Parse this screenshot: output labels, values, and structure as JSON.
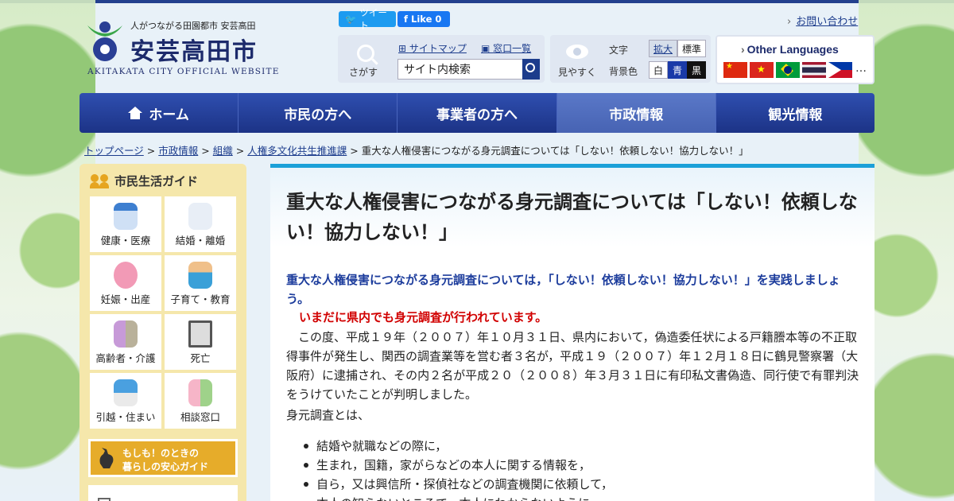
{
  "header": {
    "tagline": "人がつながる田園都市 安芸高田",
    "site_title": "安芸高田市",
    "site_title_en": "AKITAKATA CITY OFFICIAL WEBSITE",
    "tweet_label": "ツイート",
    "like_label": "Like 0",
    "contact_label": "お問い合わせ"
  },
  "search": {
    "label": "さがす",
    "sitemap_label": "サイトマップ",
    "counter_label": "窓口一覧",
    "input_value": "サイト内検索"
  },
  "view": {
    "label": "見やすく",
    "text_size_label": "文字",
    "expand_label": "拡大",
    "standard_label": "標準",
    "bg_label": "背景色",
    "white_label": "白",
    "blue_label": "青",
    "black_label": "黒"
  },
  "languages": {
    "title": "Other Languages",
    "more": "…"
  },
  "nav": {
    "items": [
      "ホーム",
      "市民の方へ",
      "事業者の方へ",
      "市政情報",
      "観光情報"
    ],
    "active_index": 3
  },
  "breadcrumb": {
    "items": [
      "トップページ",
      "市政情報",
      "組織",
      "人権多文化共生推進課"
    ],
    "current": "重大な人権侵害につながる身元調査については「しない！依頼しない！協力しない！」",
    "separator": ">"
  },
  "sidebar": {
    "heading": "市民生活ガイド",
    "guide_items": [
      "健康・医療",
      "結婚・離婚",
      "妊娠・出産",
      "子育て・教育",
      "高齢者・介護",
      "死亡",
      "引越・住まい",
      "相談窓口"
    ],
    "emergency_line1": "もしも！のときの",
    "emergency_line2": "暮らしの安心ガイド"
  },
  "content": {
    "title": "重大な人権侵害につながる身元調査については「しない！依頼しない！協力しない！」",
    "lead": "重大な人権侵害につながる身元調査については，「しない！依頼しない！協力しない！」を実践しましょう。",
    "alert": "いまだに県内でも身元調査が行われています。",
    "paragraph": "この度、平成１９年（２００７）年１０月３１日、県内において，偽造委任状による戸籍謄本等の不正取得事件が発生し、関西の調査業等を営む者３名が，平成１９（２００７）年１２月１８日に鶴見警察署（大阪府）に逮捕され、その内２名が平成２０（２００８）年３月３１日に有印私文書偽造、同行使で有罪判決をうけていたことが判明しました。",
    "definition_label": "身元調査とは、",
    "bullets": [
      "結婚や就職などの際に，",
      "生まれ，国籍，家がらなどの本人に関する情報を，",
      "自ら，又は興信所・探偵社などの調査機関に依頼して，",
      "本人の知らないところで，本人にわからないように，"
    ]
  },
  "colors": {
    "brand_navy": "#1c2a6b",
    "nav_blue": "#23408e",
    "accent_cyan": "#1ba0d8",
    "lead_blue": "#1c3c9c",
    "alert_red": "#d10000",
    "sidebar_yellow": "#f5e7ab"
  }
}
